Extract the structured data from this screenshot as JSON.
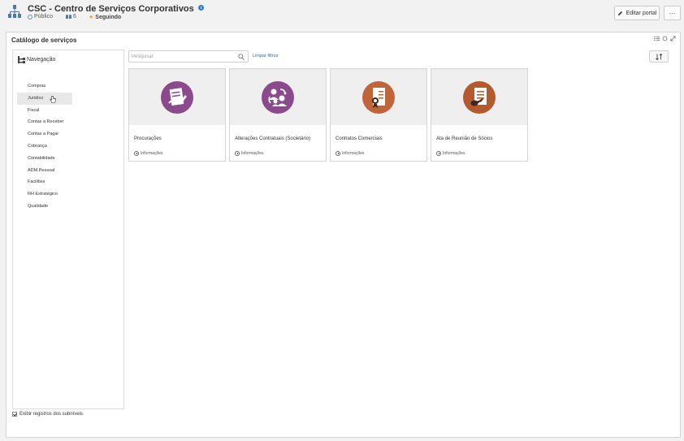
{
  "header": {
    "title": "CSC - Centro de Serviços Corporativos",
    "visibility": "Público",
    "members_count": "6",
    "follow_label": "Seguindo",
    "edit_label": "Editar portal",
    "more_label": "···"
  },
  "widget": {
    "title": "Catálogo de serviços"
  },
  "nav": {
    "heading": "Navegação",
    "items": [
      {
        "label": "Compras"
      },
      {
        "label": "Jurídico"
      },
      {
        "label": "Fiscal"
      },
      {
        "label": "Contas a Receber"
      },
      {
        "label": "Contas a Pagar"
      },
      {
        "label": "Cobrança"
      },
      {
        "label": "Contabilidade"
      },
      {
        "label": "ADM Pessoal"
      },
      {
        "label": "Facilities"
      },
      {
        "label": "RH Estratégico"
      },
      {
        "label": "Qualidade"
      }
    ],
    "hovered_item": "Jurídico",
    "subnivel_label": "Exibir registros dos subníveis",
    "subnivel_checked": true
  },
  "search": {
    "placeholder": "Pesquisar",
    "value": "",
    "clear_label": "Limpar filtros"
  },
  "cards": [
    {
      "title": "Procurações",
      "info": "Informações",
      "color": "#8a4a8c",
      "icon": "signed-document-icon"
    },
    {
      "title": "Alterações Contratuais (Societário)",
      "info": "Informações",
      "color": "#8a4a8c",
      "icon": "people-exchange-icon"
    },
    {
      "title": "Contratos Comerciais",
      "info": "Informações",
      "color": "#c0643a",
      "icon": "contract-seal-icon"
    },
    {
      "title": "Ata de Reunião de Sócios",
      "info": "Informações",
      "color": "#b45a2e",
      "icon": "minutes-stamp-icon"
    }
  ],
  "colors": {
    "link": "#2a6fb5",
    "accent_purple": "#8a4a8c",
    "accent_orange": "#c0643a"
  }
}
